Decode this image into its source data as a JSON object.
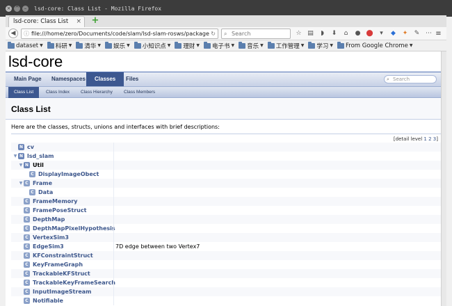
{
  "window": {
    "title": "lsd-core: Class List - Mozilla Firefox"
  },
  "browser": {
    "tab_label": "lsd-core: Class List",
    "url": "file:///home/zero/Documents/code/slam/lsd-slam-rosws/package",
    "search_placeholder": "Search"
  },
  "bookmarks": [
    {
      "label": "dataset"
    },
    {
      "label": "科研"
    },
    {
      "label": "清华"
    },
    {
      "label": "娱乐"
    },
    {
      "label": "小知识点"
    },
    {
      "label": "理财"
    },
    {
      "label": "电子书"
    },
    {
      "label": "音乐"
    },
    {
      "label": "工作管理"
    },
    {
      "label": "学习"
    },
    {
      "label": "From Google Chrome"
    }
  ],
  "doxygen": {
    "project": "lsd-core",
    "main_tabs": [
      "Main Page",
      "Namespaces",
      "Classes",
      "Files"
    ],
    "search_placeholder": "Search",
    "sub_tabs": [
      "Class List",
      "Class Index",
      "Class Hierarchy",
      "Class Members"
    ],
    "heading": "Class List",
    "description": "Here are the classes, structs, unions and interfaces with brief descriptions:",
    "detail_level_label": "[detail level",
    "detail_levels": [
      "1",
      "2",
      "3"
    ],
    "detail_close": "]"
  },
  "class_list": [
    {
      "name": "cv",
      "badge": "N",
      "brief": ""
    },
    {
      "name": "lsd_slam",
      "badge": "N",
      "brief": ""
    },
    {
      "name": "Util",
      "badge": "N",
      "brief": ""
    },
    {
      "name": "DisplayImageObect",
      "badge": "C",
      "brief": ""
    },
    {
      "name": "Frame",
      "badge": "C",
      "brief": ""
    },
    {
      "name": "Data",
      "badge": "C",
      "brief": ""
    },
    {
      "name": "FrameMemory",
      "badge": "C",
      "brief": ""
    },
    {
      "name": "FramePoseStruct",
      "badge": "C",
      "brief": ""
    },
    {
      "name": "DepthMap",
      "badge": "C",
      "brief": ""
    },
    {
      "name": "DepthMapPixelHypothesis",
      "badge": "C",
      "brief": ""
    },
    {
      "name": "VertexSim3",
      "badge": "C",
      "brief": ""
    },
    {
      "name": "EdgeSim3",
      "badge": "C",
      "brief": "7D edge between two Vertex7"
    },
    {
      "name": "KFConstraintStruct",
      "badge": "C",
      "brief": ""
    },
    {
      "name": "KeyFrameGraph",
      "badge": "C",
      "brief": ""
    },
    {
      "name": "TrackableKFStruct",
      "badge": "C",
      "brief": ""
    },
    {
      "name": "TrackableKeyFrameSearch",
      "badge": "C",
      "brief": ""
    },
    {
      "name": "InputImageStream",
      "badge": "C",
      "brief": ""
    },
    {
      "name": "Notifiable",
      "badge": "C",
      "brief": ""
    }
  ]
}
